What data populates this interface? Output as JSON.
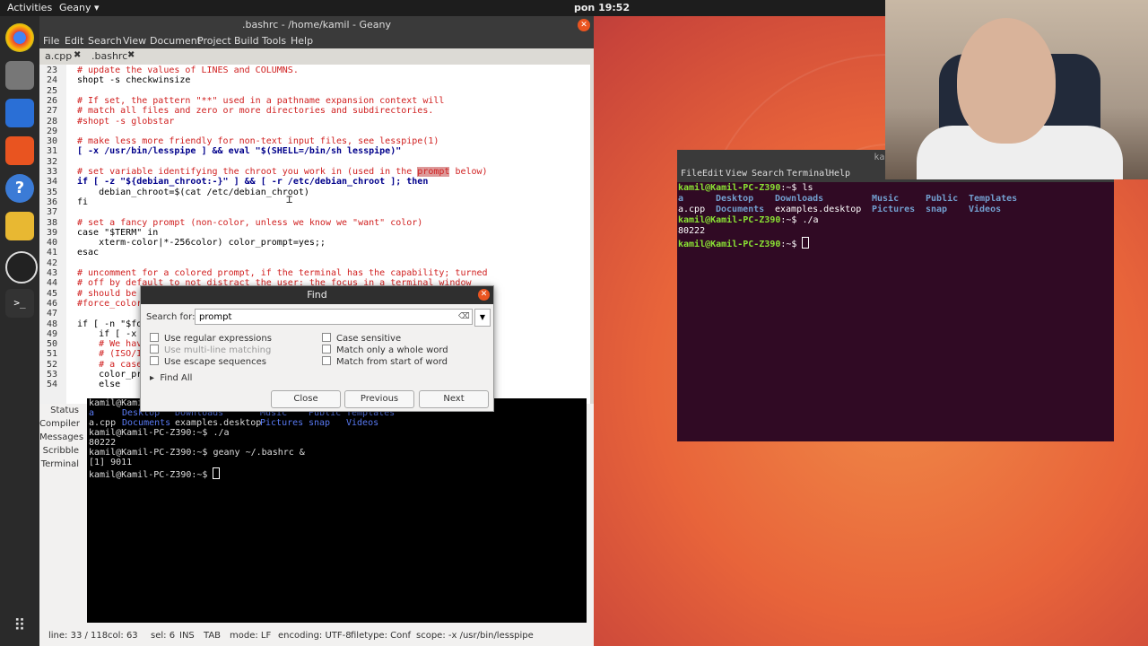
{
  "topbar": {
    "activities": "Activities",
    "app": "Geany ▾",
    "clock": "pon 19:52"
  },
  "geany": {
    "title": ".bashrc - /home/kamil - Geany",
    "menu": [
      "File",
      "Edit",
      "Search",
      "View",
      "Document",
      "Project",
      "Build",
      "Tools",
      "Help"
    ],
    "tabs": [
      {
        "label": "a.cpp"
      },
      {
        "label": ".bashrc"
      }
    ],
    "lines": [
      {
        "n": "23",
        "text": "# update the values of LINES and COLUMNS."
      },
      {
        "n": "24",
        "text": "shopt -s checkwinsize"
      },
      {
        "n": "25",
        "text": ""
      },
      {
        "n": "26",
        "text": "# If set, the pattern \"**\" used in a pathname expansion context will"
      },
      {
        "n": "27",
        "text": "# match all files and zero or more directories and subdirectories."
      },
      {
        "n": "28",
        "text": "#shopt -s globstar"
      },
      {
        "n": "29",
        "text": ""
      },
      {
        "n": "30",
        "text": "# make less more friendly for non-text input files, see lesspipe(1)"
      },
      {
        "n": "31",
        "text": "[ -x /usr/bin/lesspipe ] && eval \"$(SHELL=/bin/sh lesspipe)\""
      },
      {
        "n": "32",
        "text": ""
      },
      {
        "n": "33",
        "text": "# set variable identifying the chroot you work in (used in the ",
        "hl": "prompt",
        "after": " below)"
      },
      {
        "n": "34",
        "text": "if [ -z \"${debian_chroot:-}\" ] && [ -r /etc/debian_chroot ]; then"
      },
      {
        "n": "35",
        "text": "    debian_chroot=$(cat /etc/debian_chroot)"
      },
      {
        "n": "36",
        "text": "fi"
      },
      {
        "n": "37",
        "text": ""
      },
      {
        "n": "38",
        "text": "# set a fancy prompt (non-color, unless we know we \"want\" color)"
      },
      {
        "n": "39",
        "text": "case \"$TERM\" in"
      },
      {
        "n": "40",
        "text": "    xterm-color|*-256color) color_prompt=yes;;"
      },
      {
        "n": "41",
        "text": "esac"
      },
      {
        "n": "42",
        "text": ""
      },
      {
        "n": "43",
        "text": "# uncomment for a colored prompt, if the terminal has the capability; turned"
      },
      {
        "n": "44",
        "text": "# off by default to not distract the user: the focus in a terminal window"
      },
      {
        "n": "45",
        "text": "# should be on"
      },
      {
        "n": "46",
        "text": "#force_color_p"
      },
      {
        "n": "47",
        "text": ""
      },
      {
        "n": "48",
        "text": "if [ -n \"$forc"
      },
      {
        "n": "49",
        "text": "    if [ -x /u"
      },
      {
        "n": "50",
        "text": "    # We have"
      },
      {
        "n": "51",
        "text": "    # (ISO/IEC"
      },
      {
        "n": "52",
        "text": "    # a case w"
      },
      {
        "n": "53",
        "text": "    color_prom"
      },
      {
        "n": "54",
        "text": "    else"
      }
    ],
    "bottom_tabs": [
      "Status",
      "Compiler",
      "Messages",
      "Scribble",
      "Terminal"
    ],
    "terminal": {
      "l1": "kamil@Kamil",
      "l2a": "a",
      "l2b": "Desktop",
      "l2c": "Downloads",
      "l2d": "Music",
      "l2e": "Public",
      "l2f": "Templates",
      "l3a": "a.cpp",
      "l3b": "Documents",
      "l3c": "examples.desktop",
      "l3d": "Pictures",
      "l3e": "snap",
      "l3f": "Videos",
      "l4": "kamil@Kamil-PC-Z390:~$ ./a",
      "l5": "80222",
      "l6": "kamil@Kamil-PC-Z390:~$ geany ~/.bashrc &",
      "l7": "[1] 9011",
      "l8": "kamil@Kamil-PC-Z390:~$ "
    },
    "status": {
      "line": "line: 33 / 118",
      "col": "col: 63",
      "sel": "sel: 6",
      "ins": "INS",
      "tab": "TAB",
      "mode": "mode: LF",
      "encoding": "encoding: UTF-8",
      "filetype": "filetype: Conf",
      "scope": "scope: -x /usr/bin/lesspipe"
    }
  },
  "find": {
    "title": "Find",
    "label": "Search for:",
    "value": "prompt",
    "options_left": [
      {
        "label": "Use regular expressions",
        "enabled": true
      },
      {
        "label": "Use multi-line matching",
        "enabled": false
      },
      {
        "label": "Use escape sequences",
        "enabled": true
      }
    ],
    "options_right": [
      {
        "label": "Case sensitive"
      },
      {
        "label": "Match only a whole word"
      },
      {
        "label": "Match from start of word"
      }
    ],
    "find_all": "Find All",
    "buttons": {
      "close": "Close",
      "previous": "Previous",
      "next": "Next"
    }
  },
  "terminal2": {
    "title": "kamil@Ka",
    "menu": [
      "File",
      "Edit",
      "View",
      "Search",
      "Terminal",
      "Help"
    ],
    "prompt": "kamil@Kamil-PC-Z390",
    "cmd1": ":~$ ls",
    "r1": [
      "a",
      "Desktop",
      "Downloads",
      "Music",
      "Public",
      "Templates"
    ],
    "r2": [
      "a.cpp",
      "Documents",
      "examples.desktop",
      "Pictures",
      "snap",
      "Videos"
    ],
    "cmd2": ":~$ ./a",
    "out": "80222",
    "cmd3": ":~$ "
  },
  "colors": {
    "accent": "#e95420",
    "terminal_bg": "#300a24",
    "prompt_green": "#8ae234",
    "dir_blue": "#729fcf"
  }
}
